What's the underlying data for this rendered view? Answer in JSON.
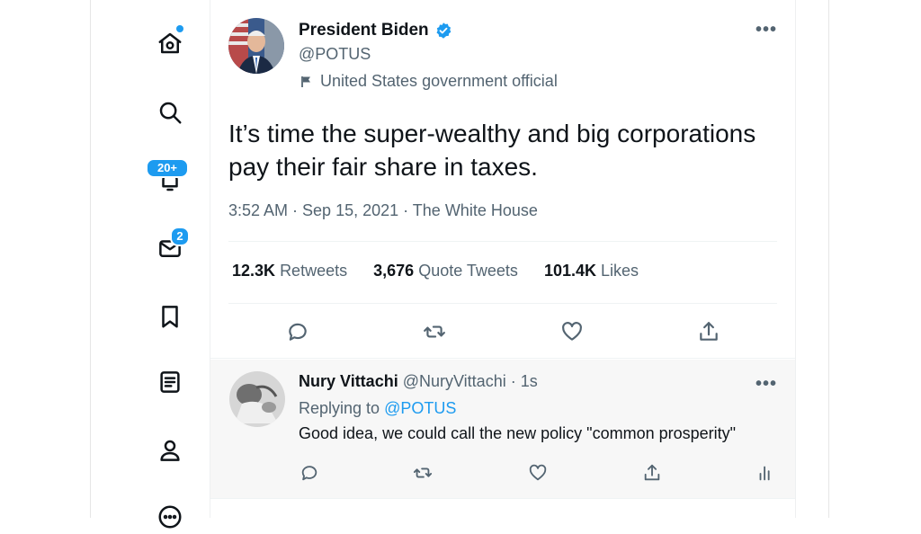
{
  "sidebar": {
    "items": [
      {
        "icon": "home-icon",
        "name": "Home"
      },
      {
        "icon": "search-icon",
        "name": "Explore"
      },
      {
        "icon": "bell-icon",
        "name": "Notifications",
        "badge": "20+"
      },
      {
        "icon": "mail-icon",
        "name": "Messages",
        "badge": "2"
      },
      {
        "icon": "bookmark-icon",
        "name": "Bookmarks"
      },
      {
        "icon": "list-icon",
        "name": "Lists"
      },
      {
        "icon": "profile-icon",
        "name": "Profile"
      },
      {
        "icon": "more-circle-icon",
        "name": "More"
      }
    ],
    "notifications_badge": "20+",
    "messages_badge": "2"
  },
  "tweet": {
    "display_name": "President Biden",
    "handle": "@POTUS",
    "label": "United States government official",
    "text": "It’s time the super-wealthy and big corporations pay their fair share in taxes.",
    "meta": "3:52 AM · Sep 15, 2021 · The White House",
    "stats": {
      "retweets_count": "12.3K",
      "retweets_label": "Retweets",
      "quotes_count": "3,676",
      "quotes_label": "Quote Tweets",
      "likes_count": "101.4K",
      "likes_label": "Likes"
    }
  },
  "reply": {
    "display_name": "Nury Vittachi",
    "handle": "@NuryVittachi",
    "time": "· 1s",
    "replying_to_label": "Replying to",
    "replying_to_handle": "@POTUS",
    "text": "Good idea, we could call the new policy \"common prosperity\""
  },
  "colors": {
    "accent": "#1d9bf0",
    "text": "#0f1419",
    "muted": "#536471"
  }
}
